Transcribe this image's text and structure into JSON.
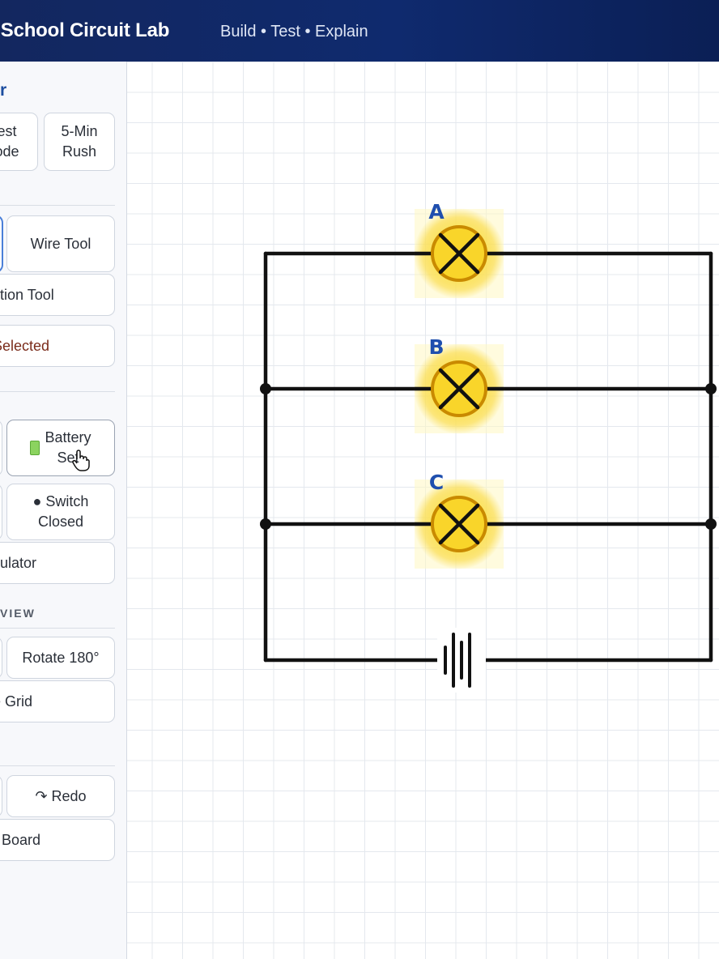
{
  "app": {
    "title": "ry School Circuit Lab",
    "subtitle": "Build • Test • Explain"
  },
  "sidebar": {
    "mode_heading": "r",
    "mode_buttons": [
      "est\node",
      "5-Min\nRush"
    ],
    "tools": {
      "wire_tool": "Wire Tool",
      "selection_tool": "ction Tool",
      "delete_selected": "Selected"
    },
    "components": {
      "battery_set": "Battery\nSet",
      "switch_closed": "● Switch\nClosed",
      "insulator": "sulator"
    },
    "view_heading": "VIEW",
    "view": {
      "rotate": "Rotate 180°",
      "grid": "e Grid"
    },
    "history": {
      "redo": "↷ Redo",
      "clear_board": "r Board"
    }
  },
  "circuit": {
    "bulbs": [
      {
        "label": "A",
        "state": "lit"
      },
      {
        "label": "B",
        "state": "lit"
      },
      {
        "label": "C",
        "state": "lit"
      }
    ],
    "battery": "battery-symbol",
    "colors": {
      "bulb_glow": "#f9d52a",
      "bulb_ring": "#c98a00",
      "wire": "#111111",
      "label": "#1f4fae",
      "accent": "#4a7fd8"
    }
  }
}
